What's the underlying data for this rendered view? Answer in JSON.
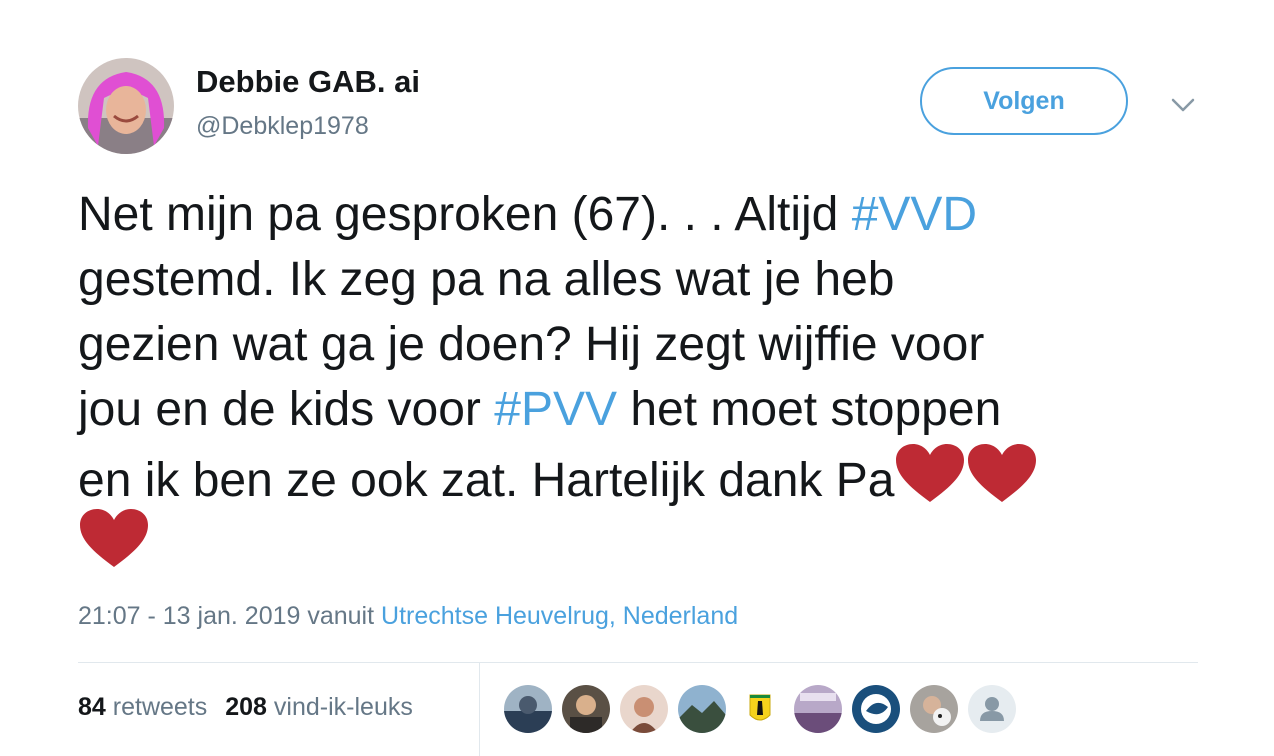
{
  "user": {
    "display_name": "Debbie GAB. ai",
    "handle": "@Debklep1978"
  },
  "actions": {
    "follow_label": "Volgen"
  },
  "tweet": {
    "lines": [
      [
        "Net mijn pa gesproken (67). . . Altijd ",
        "#VVD",
        ""
      ],
      [
        "gestemd. Ik zeg pa na alles  wat je heb"
      ],
      [
        "gezien wat ga je doen? Hij zegt wijffie voor"
      ],
      [
        "jou en de kids voor ",
        "#PVV",
        " het moet stoppen"
      ],
      [
        "en ik ben ze ook zat. Hartelijk dank Pa"
      ]
    ],
    "hashtag_vvd": "#VVD",
    "hashtag_pvv": "#PVV",
    "heart_color": "#be2a34"
  },
  "meta": {
    "time": "21:07 - 13 jan. 2019 vanuit ",
    "location": "Utrechtse Heuvelrug, Nederland"
  },
  "stats": {
    "retweets_count": "84",
    "retweets_label": "retweets",
    "likes_count": "208",
    "likes_label": "vind-ik-leuks"
  },
  "colors": {
    "link": "#4aa1de",
    "secondary_text": "#657786",
    "divider": "#e1e8ed"
  }
}
